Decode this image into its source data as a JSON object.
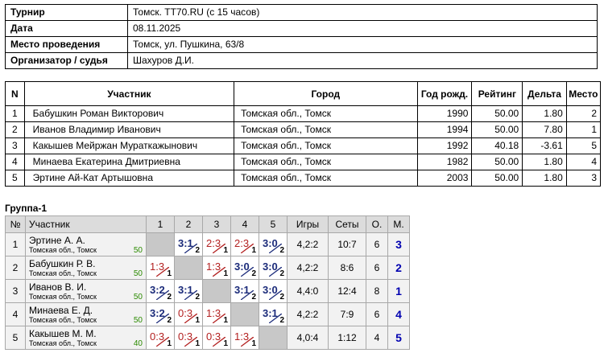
{
  "info": {
    "rows": [
      {
        "label": "Турнир",
        "value": "Томск. TT70.RU (с 15 часов)"
      },
      {
        "label": "Дата",
        "value": "08.11.2025"
      },
      {
        "label": "Место проведения",
        "value": "Томск, ул. Пушкина, 63/8"
      },
      {
        "label": "Организатор / судья",
        "value": "Шахуров Д.И."
      }
    ]
  },
  "participants": {
    "headers": [
      "N",
      "Участник",
      "Город",
      "Год рожд.",
      "Рейтинг",
      "Дельта",
      "Место"
    ],
    "rows": [
      {
        "n": "1",
        "name": "Бабушкин Роман Викторович",
        "city": "Томская обл., Томск",
        "year": "1990",
        "rating": "50.00",
        "delta": "1.80",
        "place": "2"
      },
      {
        "n": "2",
        "name": "Иванов Владимир Иванович",
        "city": "Томская обл., Томск",
        "year": "1994",
        "rating": "50.00",
        "delta": "7.80",
        "place": "1"
      },
      {
        "n": "3",
        "name": "Какышев Мейржан Мураткажынович",
        "city": "Томская обл., Томск",
        "year": "1992",
        "rating": "40.18",
        "delta": "-3.61",
        "place": "5"
      },
      {
        "n": "4",
        "name": "Минаева Екатерина Дмитриевна",
        "city": "Томская обл., Томск",
        "year": "1982",
        "rating": "50.00",
        "delta": "1.80",
        "place": "4"
      },
      {
        "n": "5",
        "name": "Эртине Ай-Кат Артышовна",
        "city": "Томская обл., Томск",
        "year": "2003",
        "rating": "50.00",
        "delta": "1.80",
        "place": "3"
      }
    ]
  },
  "group": {
    "title": "Группа-1",
    "headers": {
      "n": "№",
      "player": "Участник",
      "cols": [
        "1",
        "2",
        "3",
        "4",
        "5"
      ],
      "games": "Игры",
      "sets": "Сеты",
      "points": "О.",
      "place": "М."
    },
    "colors": {
      "win": "#1b2b7a",
      "loss": "#b32020",
      "rating": "#2b8a00",
      "place": "#0000b0",
      "diag": "#c8c8c8"
    },
    "rows": [
      {
        "n": "1",
        "name": "Эртине А. А.",
        "city": "Томская обл., Томск",
        "rating": "50",
        "results": [
          null,
          {
            "s": "3:1",
            "p": "2",
            "w": true
          },
          {
            "s": "2:3",
            "p": "1",
            "w": false
          },
          {
            "s": "2:3",
            "p": "1",
            "w": false
          },
          {
            "s": "3:0",
            "p": "2",
            "w": true
          }
        ],
        "games": "4,2:2",
        "sets": "10:7",
        "points": "6",
        "place": "3"
      },
      {
        "n": "2",
        "name": "Бабушкин Р. В.",
        "city": "Томская обл., Томск",
        "rating": "50",
        "results": [
          {
            "s": "1:3",
            "p": "1",
            "w": false
          },
          null,
          {
            "s": "1:3",
            "p": "1",
            "w": false
          },
          {
            "s": "3:0",
            "p": "2",
            "w": true
          },
          {
            "s": "3:0",
            "p": "2",
            "w": true
          }
        ],
        "games": "4,2:2",
        "sets": "8:6",
        "points": "6",
        "place": "2"
      },
      {
        "n": "3",
        "name": "Иванов В. И.",
        "city": "Томская обл., Томск",
        "rating": "50",
        "results": [
          {
            "s": "3:2",
            "p": "2",
            "w": true
          },
          {
            "s": "3:1",
            "p": "2",
            "w": true
          },
          null,
          {
            "s": "3:1",
            "p": "2",
            "w": true
          },
          {
            "s": "3:0",
            "p": "2",
            "w": true
          }
        ],
        "games": "4,4:0",
        "sets": "12:4",
        "points": "8",
        "place": "1"
      },
      {
        "n": "4",
        "name": "Минаева Е. Д.",
        "city": "Томская обл., Томск",
        "rating": "50",
        "results": [
          {
            "s": "3:2",
            "p": "2",
            "w": true
          },
          {
            "s": "0:3",
            "p": "1",
            "w": false
          },
          {
            "s": "1:3",
            "p": "1",
            "w": false
          },
          null,
          {
            "s": "3:1",
            "p": "2",
            "w": true
          }
        ],
        "games": "4,2:2",
        "sets": "7:9",
        "points": "6",
        "place": "4"
      },
      {
        "n": "5",
        "name": "Какышев М. М.",
        "city": "Томская обл., Томск",
        "rating": "40",
        "results": [
          {
            "s": "0:3",
            "p": "1",
            "w": false
          },
          {
            "s": "0:3",
            "p": "1",
            "w": false
          },
          {
            "s": "0:3",
            "p": "1",
            "w": false
          },
          {
            "s": "1:3",
            "p": "1",
            "w": false
          },
          null
        ],
        "games": "4,0:4",
        "sets": "1:12",
        "points": "4",
        "place": "5"
      }
    ]
  }
}
